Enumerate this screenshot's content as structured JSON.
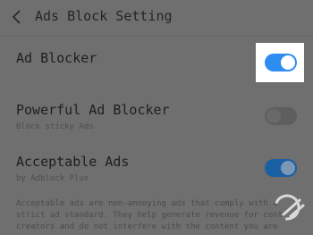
{
  "header": {
    "title": "Ads Block Setting",
    "back_icon": "chevron-left-icon"
  },
  "settings": [
    {
      "label": "Ad Blocker",
      "subtitle": "",
      "enabled": true
    },
    {
      "label": "Powerful Ad Blocker",
      "subtitle": "Block sticky Ads",
      "enabled": false
    },
    {
      "label": "Acceptable Ads",
      "subtitle": "by  Adblock Plus",
      "enabled": true
    }
  ],
  "description": {
    "lines": [
      "Acceptable ads are non-annoying ads that comply with a",
      "strict ad standard. They help generate revenue for cont",
      "creators and do not interfere with the content you are"
    ]
  },
  "colors": {
    "background": "#6f6f6f",
    "toggle_on": "#1b5fa3",
    "toggle_highlight": "#2f8cf0",
    "toggle_off": "#5e5e5e"
  },
  "watermark": {
    "icon": "brand-logo-icon"
  }
}
